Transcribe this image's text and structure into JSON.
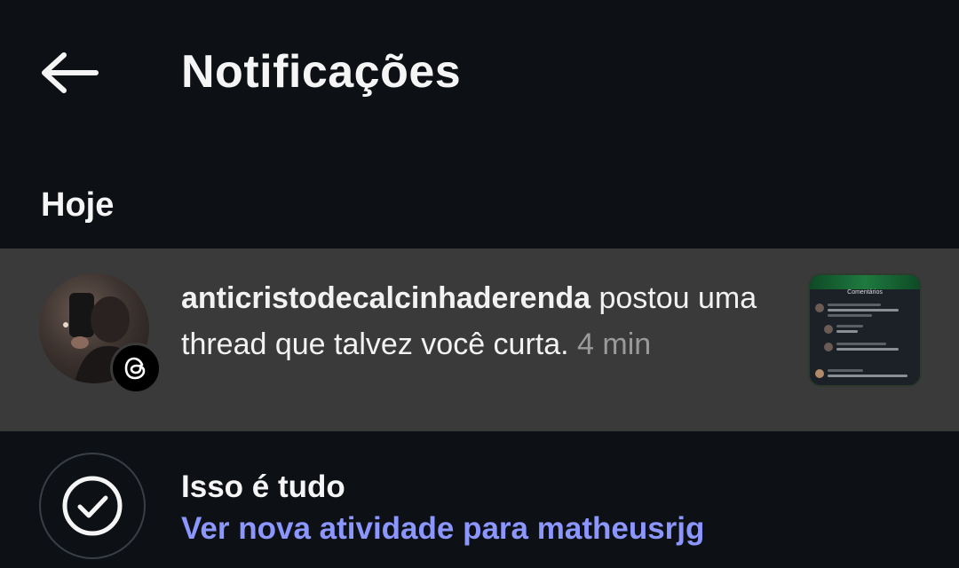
{
  "header": {
    "back_icon": "arrow-left-icon",
    "title": "Notificações"
  },
  "sections": [
    {
      "title": "Hoje",
      "notifications": [
        {
          "username": "anticristodecalcinhaderenda",
          "message": " postou uma thread que talvez você curta. ",
          "time": "4 min",
          "badge_icon": "threads-icon",
          "thumbnail_title": "Comentários"
        }
      ]
    }
  ],
  "end": {
    "icon": "checkmark-circle-icon",
    "title": "Isso é tudo",
    "link": "Ver nova atividade para matheusrjg"
  },
  "colors": {
    "background": "#0d1116",
    "highlight_row": "#3a3a3a",
    "link": "#8c96ff",
    "muted": "#9a9a9a"
  }
}
